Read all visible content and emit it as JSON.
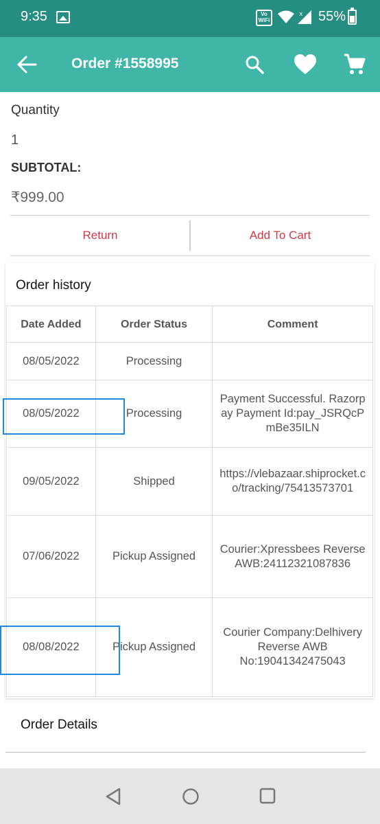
{
  "status_bar": {
    "time": "9:35",
    "volte_label": "Vo WiFi",
    "battery": "55%"
  },
  "app_bar": {
    "title": "Order #1558995",
    "icons": [
      "back-arrow-icon",
      "search-icon",
      "heart-icon",
      "cart-icon"
    ]
  },
  "summary": {
    "quantity_label": "Quantity",
    "quantity_value": "1",
    "subtotal_label": "SUBTOTAL:",
    "subtotal_value": "₹999.00"
  },
  "actions": {
    "return_label": "Return",
    "add_to_cart_label": "Add To Cart"
  },
  "order_history": {
    "heading": "Order history",
    "columns": [
      "Date Added",
      "Order Status",
      "Comment"
    ],
    "rows": [
      {
        "date": "08/05/2022",
        "status": "Processing",
        "comment": ""
      },
      {
        "date": "08/05/2022",
        "status": "Processing",
        "comment": "Payment Successful. Razorpay Payment Id:pay_JSRQcPmBe35ILN"
      },
      {
        "date": "09/05/2022",
        "status": "Shipped",
        "comment": "https://vlebazaar.shiprocket.co/tracking/75413573701"
      },
      {
        "date": "07/06/2022",
        "status": "Pickup Assigned",
        "comment": "Courier:Xpressbees Reverse AWB:24112321087836"
      },
      {
        "date": "08/08/2022",
        "status": "Pickup Assigned",
        "comment": "Courier Company:Delhivery Reverse AWB No:19041342475043"
      }
    ]
  },
  "order_details": {
    "heading": "Order Details"
  },
  "colors": {
    "status_bar": "#268d82",
    "app_bar": "#3fb6a8",
    "action_text": "#cf3b4b",
    "highlight": "#1e88e5"
  },
  "nav_bar": {
    "icons": [
      "nav-back-icon",
      "nav-home-icon",
      "nav-recents-icon"
    ]
  }
}
